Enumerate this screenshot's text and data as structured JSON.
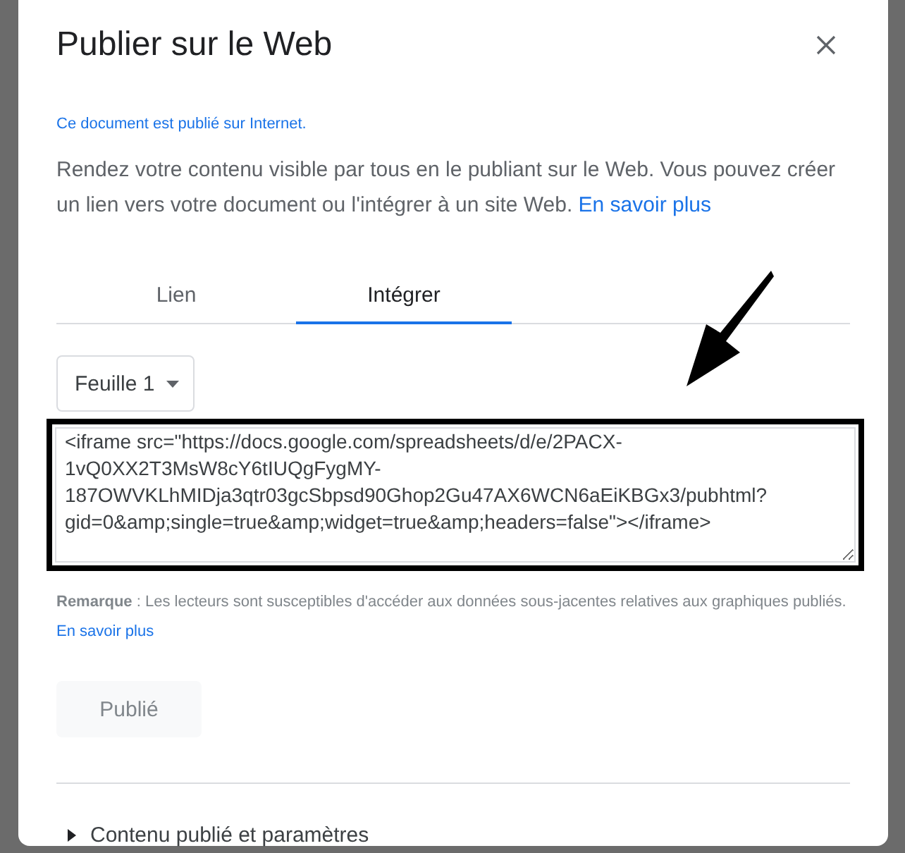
{
  "dialog": {
    "title": "Publier sur le Web",
    "status": "Ce document est publié sur Internet.",
    "description": "Rendez votre contenu visible par tous en le publiant sur le Web. Vous pouvez créer un lien vers votre document ou l'intégrer à un site Web.",
    "description_link": "En savoir plus"
  },
  "tabs": [
    {
      "label": "Lien",
      "selected": false
    },
    {
      "label": "Intégrer",
      "selected": true
    }
  ],
  "sheet_dropdown": {
    "value": "Feuille 1"
  },
  "embed_code": {
    "value": "<iframe src=\"https://docs.google.com/spreadsheets/d/e/2PACX-1vQ0XX2T3MsW8cY6tIUQgFygMY-187OWVKLhMIDja3qtr03gcSbpsd90Ghop2Gu47AX6WCN6aEiKBGx3/pubhtml?gid=0&amp;single=true&amp;widget=true&amp;headers=false\"></iframe>"
  },
  "note": {
    "text": "**Remarque** : Les lecteurs sont susceptibles d'accéder aux données sous-jacentes relatives aux graphiques publiés.",
    "link": "En savoir plus"
  },
  "publish_button": {
    "label": "Publié",
    "disabled": true
  },
  "settings_section": {
    "label": "Contenu publié et paramètres",
    "expanded": false
  }
}
